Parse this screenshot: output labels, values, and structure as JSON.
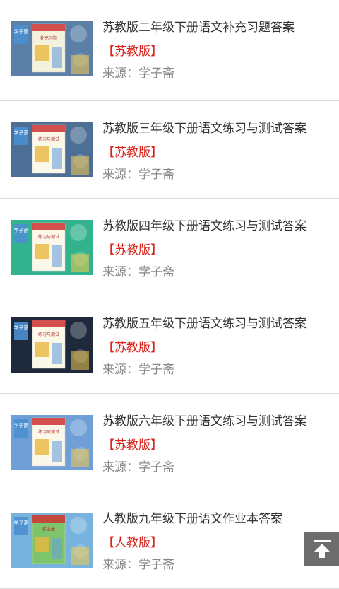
{
  "articles": [
    {
      "title": "苏教版二年级下册语文补充习题答案",
      "tag": "【苏教版】",
      "source": "来源：学子斋",
      "bg": "#5b7fa6",
      "cover": "#f4f1dd",
      "logo": "学子斋",
      "cover_title": "补充习题"
    },
    {
      "title": "苏教版三年级下册语文练习与测试答案",
      "tag": "【苏教版】",
      "source": "来源：学子斋",
      "bg": "#4e6f95",
      "cover": "#fbf8ea",
      "logo": "学子斋",
      "cover_title": "练习与测试"
    },
    {
      "title": "苏教版四年级下册语文练习与测试答案",
      "tag": "【苏教版】",
      "source": "来源：学子斋",
      "bg": "#33b38d",
      "cover": "#fbf8ea",
      "logo": "学子斋",
      "cover_title": "练习与测试"
    },
    {
      "title": "苏教版五年级下册语文练习与测试答案",
      "tag": "【苏教版】",
      "source": "来源：学子斋",
      "bg": "#1e2a3c",
      "cover": "#fbf8ea",
      "logo": "学子斋",
      "cover_title": "练习与测试"
    },
    {
      "title": "苏教版六年级下册语文练习与测试答案",
      "tag": "【苏教版】",
      "source": "来源：学子斋",
      "bg": "#6f9fd6",
      "cover": "#fbf8ea",
      "logo": "学子斋",
      "cover_title": "练习与测试"
    },
    {
      "title": "人教版九年级下册语文作业本答案",
      "tag": "【人教版】",
      "source": "来源：学子斋",
      "bg": "#77b3dc",
      "cover": "#7dc46a",
      "logo": "学子斋",
      "cover_title": "作业本"
    }
  ],
  "back_to_top": {
    "icon": "arrow-up-to-line-icon"
  }
}
